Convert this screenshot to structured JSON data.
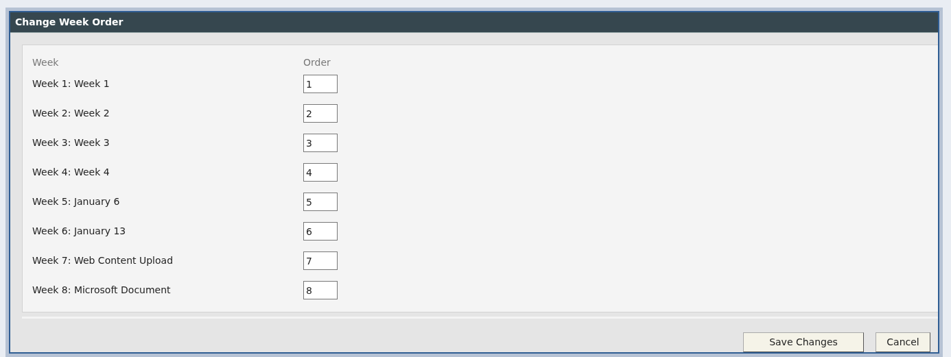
{
  "window": {
    "title": "Change Week Order"
  },
  "columns": [
    "Week",
    "Order"
  ],
  "rows": [
    {
      "week": "Week 1: Week 1",
      "order": "1"
    },
    {
      "week": "Week 2: Week 2",
      "order": "2"
    },
    {
      "week": "Week 3: Week 3",
      "order": "3"
    },
    {
      "week": "Week 4: Week 4",
      "order": "4"
    },
    {
      "week": "Week 5: January 6",
      "order": "5"
    },
    {
      "week": "Week 6: January 13",
      "order": "6"
    },
    {
      "week": "Week 7: Web Content Upload",
      "order": "7"
    },
    {
      "week": "Week 8: Microsoft Document",
      "order": "8"
    }
  ],
  "buttons": [
    "Save Changes",
    "Cancel"
  ]
}
